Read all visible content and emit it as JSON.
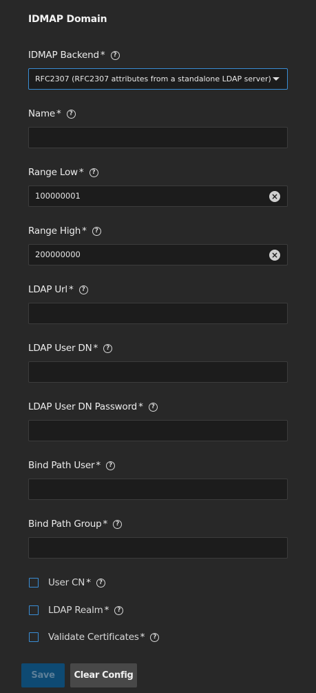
{
  "form": {
    "title": "IDMAP Domain",
    "required_marker": "*",
    "backend": {
      "label": "IDMAP Backend",
      "value": "RFC2307 (RFC2307 attributes from a standalone LDAP server)"
    },
    "fields": {
      "name": {
        "label": "Name",
        "value": ""
      },
      "range_low": {
        "label": "Range Low",
        "value": "100000001"
      },
      "range_high": {
        "label": "Range High",
        "value": "200000000"
      },
      "ldap_url": {
        "label": "LDAP Url",
        "value": ""
      },
      "ldap_user_dn": {
        "label": "LDAP User DN",
        "value": ""
      },
      "ldap_user_dn_password": {
        "label": "LDAP User DN Password",
        "value": ""
      },
      "bind_path_user": {
        "label": "Bind Path User",
        "value": ""
      },
      "bind_path_group": {
        "label": "Bind Path Group",
        "value": ""
      }
    },
    "checkboxes": {
      "user_cn": {
        "label": "User CN",
        "checked": false
      },
      "ldap_realm": {
        "label": "LDAP Realm",
        "checked": false
      },
      "validate_certificates": {
        "label": "Validate Certificates",
        "checked": false
      }
    },
    "buttons": {
      "save": "Save",
      "clear_config": "Clear Config"
    },
    "help_glyph": "?",
    "clear_glyph": "×"
  },
  "colors": {
    "background": "#282828",
    "input_background": "#1c1c1c",
    "accent": "#3a8ed6",
    "save_disabled_bg": "#0e4a73",
    "secondary_button_bg": "#484848"
  },
  "icons": {
    "help": "help-circle-icon",
    "clear": "clear-circle-icon",
    "dropdown": "chevron-down-icon"
  }
}
